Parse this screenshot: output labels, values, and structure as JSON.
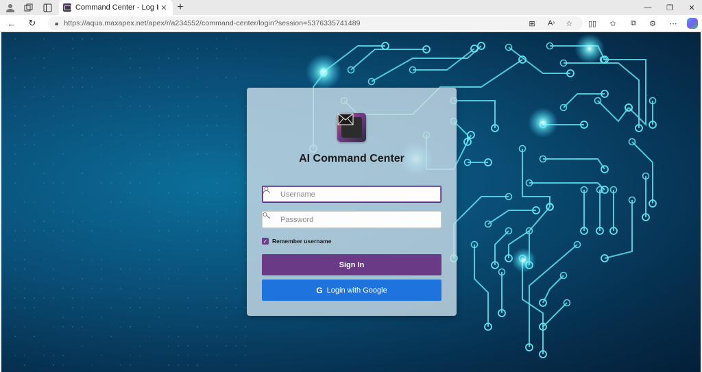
{
  "browser": {
    "tab_title": "Command Center - Log In",
    "url": "https://aqua.maxapex.net/apex/r/a234552/command-center/login?session=5376335741489"
  },
  "login": {
    "title": "AI Command Center",
    "username_placeholder": "Username",
    "password_placeholder": "Password",
    "remember_label": "Remember username",
    "remember_checked": true,
    "signin_label": "Sign In",
    "google_label": "Login with Google"
  },
  "colors": {
    "signin": "#6a3a86",
    "google": "#1f73dd",
    "circuit": "#5fe3f0"
  }
}
